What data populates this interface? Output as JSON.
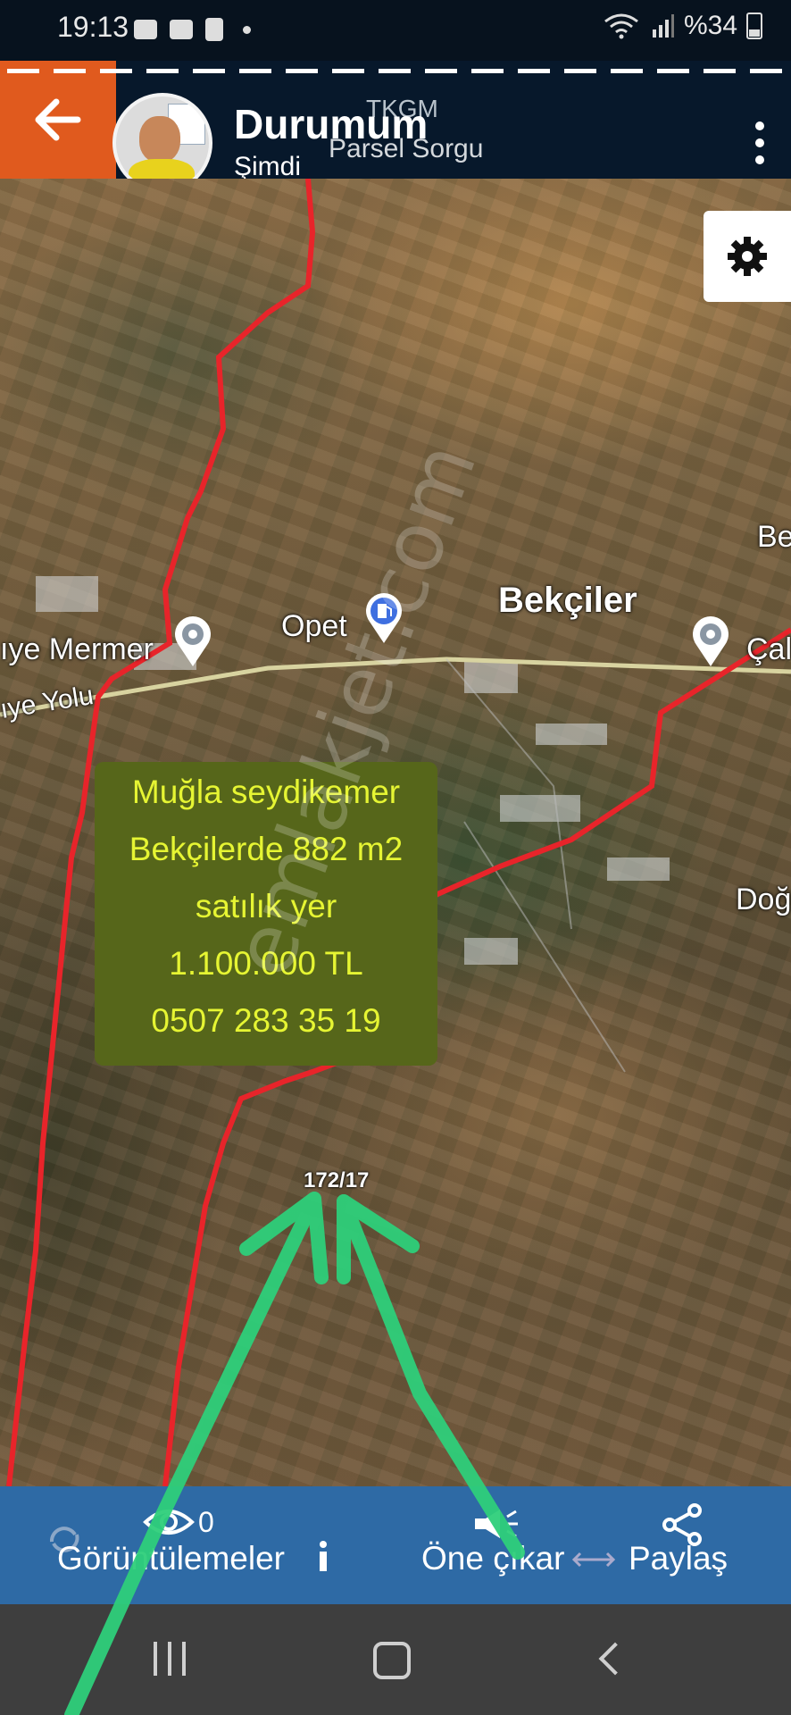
{
  "status_bar": {
    "time": "19:13",
    "left_icons": [
      "youtube-icon",
      "image-icon",
      "pdf-icon",
      "dot-icon"
    ],
    "battery_text": "%34",
    "right_icons": [
      "wifi-icon",
      "signal-icon",
      "battery-icon"
    ]
  },
  "header": {
    "title": "Durumum",
    "subtitle": "Şimdi",
    "map_title": "TKGM",
    "map_subtitle": "Parsel Sorgu",
    "colors": {
      "header_bg": "#07182b",
      "back_bg": "#e05a1e"
    }
  },
  "map": {
    "places": {
      "mermer": "ıye Mermer",
      "opet": "Opet",
      "bekciler": "Bekçiler",
      "cal": "Çal",
      "be": "Be",
      "road": "ıye Yolu",
      "dog": "Doğ"
    },
    "parcel_number": "172/17",
    "watermark": "emlakjet.com",
    "colors": {
      "boundary": "#e8242a",
      "arrows": "#2ecf7a"
    }
  },
  "ad": {
    "lines": [
      "Muğla seydikemer",
      "Bekçilerde 882 m2",
      "satılık yer",
      "1.100.000 TL",
      "0507 283 35 19"
    ],
    "colors": {
      "background": "#56661a",
      "text": "#e6f533"
    }
  },
  "bottom_bar": {
    "views_count": "0",
    "views_label": "Görüntülemeler",
    "promote_label": "Öne çıkar",
    "share_label": "Paylaş",
    "colors": {
      "background": "#2e6aa5"
    }
  },
  "nav_bar": {
    "icons": [
      "recent-apps-icon",
      "home-icon",
      "back-icon"
    ]
  }
}
